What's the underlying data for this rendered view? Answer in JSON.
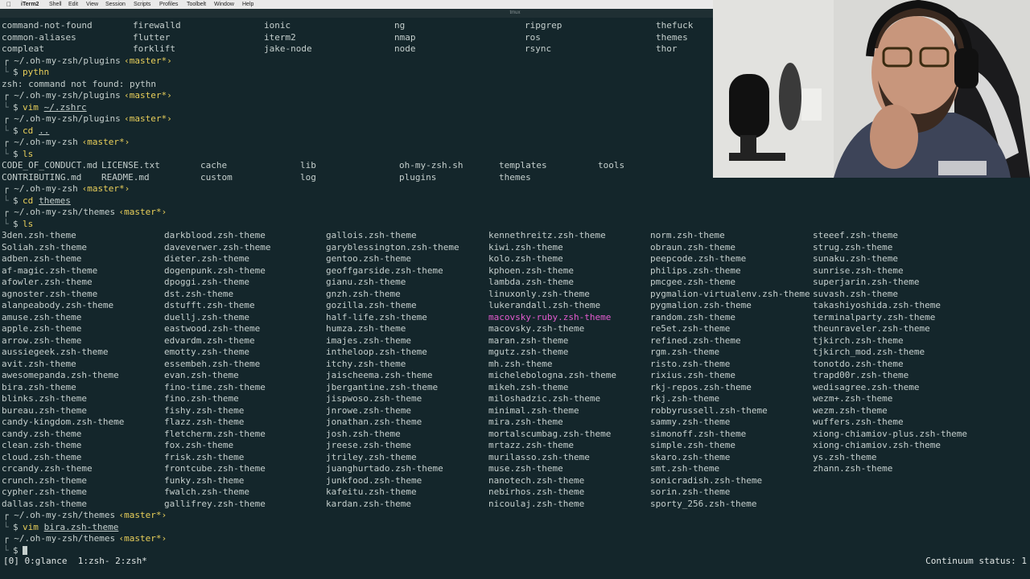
{
  "menubar": {
    "app_name": "iTerm2",
    "items": [
      "Shell",
      "Edit",
      "View",
      "Session",
      "Scripts",
      "Profiles",
      "Toolbelt",
      "Window",
      "Help"
    ]
  },
  "window": {
    "title": "tmux"
  },
  "colors": {
    "background": "#14262b",
    "text": "#c5cfcd",
    "accent_yellow": "#e9cf5a",
    "highlight_pink": "#e45bd0"
  },
  "terminal": {
    "plugins_rows": [
      [
        "command-not-found",
        "firewalld",
        "ionic",
        "ng",
        "ripgrep",
        "thefuck"
      ],
      [
        "common-aliases",
        "flutter",
        "iterm2",
        "nmap",
        "ros",
        "themes"
      ],
      [
        "compleat",
        "forklift",
        "jake-node",
        "node",
        "rsync",
        "thor"
      ]
    ],
    "prompt_arrow": "└",
    "prompt_top": "┌",
    "path_plugins": "~/.oh-my-zsh/plugins",
    "path_root": "~/.oh-my-zsh",
    "path_themes": "~/.oh-my-zsh/themes",
    "branch": "‹master*›",
    "cmd_pythn": "pythn",
    "error_line": "zsh: command not found: pythn",
    "cmd_vim": "vim",
    "arg_zshrc": "~/.zshrc",
    "cmd_cd": "cd",
    "arg_dotdot": "..",
    "cmd_ls": "ls",
    "root_rows": [
      [
        "CODE_OF_CONDUCT.md",
        "LICENSE.txt",
        "cache",
        "lib",
        "oh-my-zsh.sh",
        "templates",
        "tools"
      ],
      [
        "CONTRIBUTING.md",
        "README.md",
        "custom",
        "log",
        "plugins",
        "themes",
        ""
      ]
    ],
    "arg_themes": "themes",
    "theme_rows": [
      [
        "3den.zsh-theme",
        "darkblood.zsh-theme",
        "gallois.zsh-theme",
        "kennethreitz.zsh-theme",
        "norm.zsh-theme",
        "steeef.zsh-theme"
      ],
      [
        "Soliah.zsh-theme",
        "daveverwer.zsh-theme",
        "garyblessington.zsh-theme",
        "kiwi.zsh-theme",
        "obraun.zsh-theme",
        "strug.zsh-theme"
      ],
      [
        "adben.zsh-theme",
        "dieter.zsh-theme",
        "gentoo.zsh-theme",
        "kolo.zsh-theme",
        "peepcode.zsh-theme",
        "sunaku.zsh-theme"
      ],
      [
        "af-magic.zsh-theme",
        "dogenpunk.zsh-theme",
        "geoffgarside.zsh-theme",
        "kphoen.zsh-theme",
        "philips.zsh-theme",
        "sunrise.zsh-theme"
      ],
      [
        "afowler.zsh-theme",
        "dpoggi.zsh-theme",
        "gianu.zsh-theme",
        "lambda.zsh-theme",
        "pmcgee.zsh-theme",
        "superjarin.zsh-theme"
      ],
      [
        "agnoster.zsh-theme",
        "dst.zsh-theme",
        "gnzh.zsh-theme",
        "linuxonly.zsh-theme",
        "pygmalion-virtualenv.zsh-theme",
        "suvash.zsh-theme"
      ],
      [
        "alanpeabody.zsh-theme",
        "dstufft.zsh-theme",
        "gozilla.zsh-theme",
        "lukerandall.zsh-theme",
        "pygmalion.zsh-theme",
        "takashiyoshida.zsh-theme"
      ],
      [
        "amuse.zsh-theme",
        "duellj.zsh-theme",
        "half-life.zsh-theme",
        "macovsky-ruby.zsh-theme",
        "random.zsh-theme",
        "terminalparty.zsh-theme"
      ],
      [
        "apple.zsh-theme",
        "eastwood.zsh-theme",
        "humza.zsh-theme",
        "macovsky.zsh-theme",
        "re5et.zsh-theme",
        "theunraveler.zsh-theme"
      ],
      [
        "arrow.zsh-theme",
        "edvardm.zsh-theme",
        "imajes.zsh-theme",
        "maran.zsh-theme",
        "refined.zsh-theme",
        "tjkirch.zsh-theme"
      ],
      [
        "aussiegeek.zsh-theme",
        "emotty.zsh-theme",
        "intheloop.zsh-theme",
        "mgutz.zsh-theme",
        "rgm.zsh-theme",
        "tjkirch_mod.zsh-theme"
      ],
      [
        "avit.zsh-theme",
        "essembeh.zsh-theme",
        "itchy.zsh-theme",
        "mh.zsh-theme",
        "risto.zsh-theme",
        "tonotdo.zsh-theme"
      ],
      [
        "awesomepanda.zsh-theme",
        "evan.zsh-theme",
        "jaischeema.zsh-theme",
        "michelebologna.zsh-theme",
        "rixius.zsh-theme",
        "trapd00r.zsh-theme"
      ],
      [
        "bira.zsh-theme",
        "fino-time.zsh-theme",
        "jbergantine.zsh-theme",
        "mikeh.zsh-theme",
        "rkj-repos.zsh-theme",
        "wedisagree.zsh-theme"
      ],
      [
        "blinks.zsh-theme",
        "fino.zsh-theme",
        "jispwoso.zsh-theme",
        "miloshadzic.zsh-theme",
        "rkj.zsh-theme",
        "wezm+.zsh-theme"
      ],
      [
        "bureau.zsh-theme",
        "fishy.zsh-theme",
        "jnrowe.zsh-theme",
        "minimal.zsh-theme",
        "robbyrussell.zsh-theme",
        "wezm.zsh-theme"
      ],
      [
        "candy-kingdom.zsh-theme",
        "flazz.zsh-theme",
        "jonathan.zsh-theme",
        "mira.zsh-theme",
        "sammy.zsh-theme",
        "wuffers.zsh-theme"
      ],
      [
        "candy.zsh-theme",
        "fletcherm.zsh-theme",
        "josh.zsh-theme",
        "mortalscumbag.zsh-theme",
        "simonoff.zsh-theme",
        "xiong-chiamiov-plus.zsh-theme"
      ],
      [
        "clean.zsh-theme",
        "fox.zsh-theme",
        "jreese.zsh-theme",
        "mrtazz.zsh-theme",
        "simple.zsh-theme",
        "xiong-chiamiov.zsh-theme"
      ],
      [
        "cloud.zsh-theme",
        "frisk.zsh-theme",
        "jtriley.zsh-theme",
        "murilasso.zsh-theme",
        "skaro.zsh-theme",
        "ys.zsh-theme"
      ],
      [
        "crcandy.zsh-theme",
        "frontcube.zsh-theme",
        "juanghurtado.zsh-theme",
        "muse.zsh-theme",
        "smt.zsh-theme",
        "zhann.zsh-theme"
      ],
      [
        "crunch.zsh-theme",
        "funky.zsh-theme",
        "junkfood.zsh-theme",
        "nanotech.zsh-theme",
        "sonicradish.zsh-theme",
        ""
      ],
      [
        "cypher.zsh-theme",
        "fwalch.zsh-theme",
        "kafeitu.zsh-theme",
        "nebirhos.zsh-theme",
        "sorin.zsh-theme",
        ""
      ],
      [
        "dallas.zsh-theme",
        "gallifrey.zsh-theme",
        "kardan.zsh-theme",
        "nicoulaj.zsh-theme",
        "sporty_256.zsh-theme",
        ""
      ]
    ],
    "arg_bira": "bira.zsh-theme",
    "prompt_dollar": "$"
  },
  "statusbar": {
    "window_list": "[0] 0:glance  1:zsh- 2:zsh*",
    "right_text": "Continuum status: 1"
  },
  "webcam": {
    "name": "webcam-overlay"
  }
}
